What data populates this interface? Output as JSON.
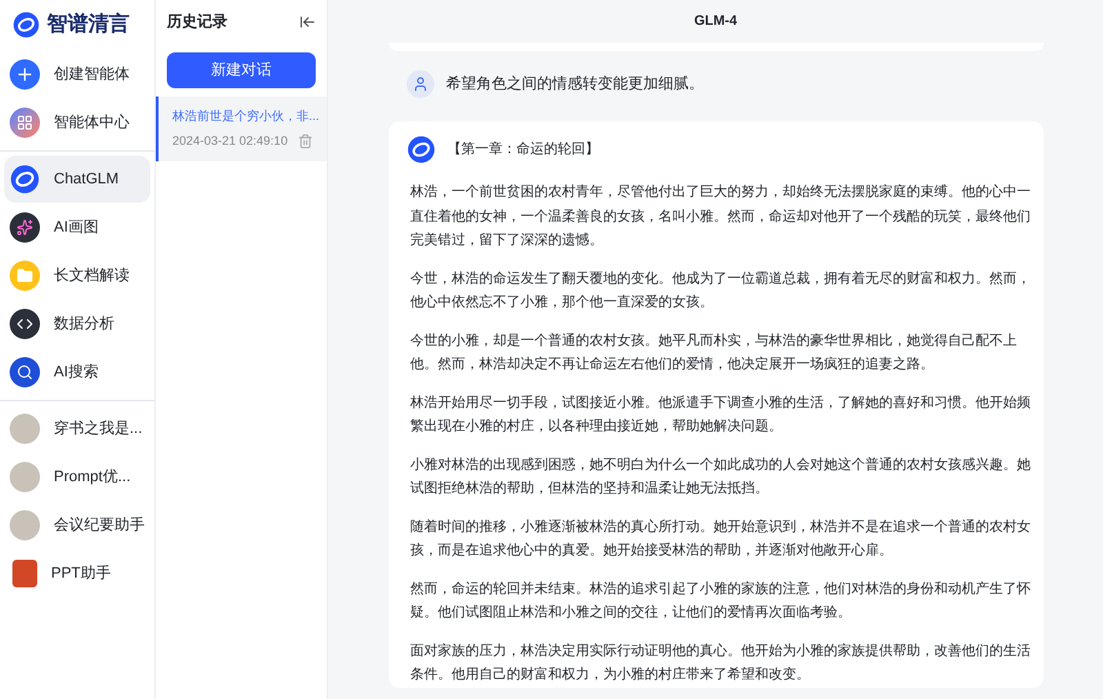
{
  "brand": {
    "name": "智谱清言"
  },
  "nav_groups": [
    {
      "items": [
        {
          "label": "创建智能体",
          "kind": "create",
          "selected": false
        },
        {
          "label": "智能体中心",
          "kind": "hub",
          "selected": false
        }
      ]
    },
    {
      "items": [
        {
          "label": "ChatGLM",
          "kind": "chat",
          "selected": true
        },
        {
          "label": "AI画图",
          "kind": "draw",
          "selected": false
        },
        {
          "label": "长文档解读",
          "kind": "doc",
          "selected": false
        },
        {
          "label": "数据分析",
          "kind": "code",
          "selected": false
        },
        {
          "label": "AI搜索",
          "kind": "search",
          "selected": false
        }
      ]
    },
    {
      "items": [
        {
          "label": "穿书之我是...",
          "kind": "avatar",
          "selected": false
        },
        {
          "label": "Prompt优...",
          "kind": "avatar",
          "selected": false
        },
        {
          "label": "会议纪要助手",
          "kind": "avatar",
          "selected": false
        },
        {
          "label": "PPT助手",
          "kind": "ppt",
          "selected": false
        }
      ]
    }
  ],
  "history": {
    "title": "历史记录",
    "new_button": "新建对话",
    "items": [
      {
        "title": "林浩前世是个穷小伙，非...",
        "time": "2024-03-21 02:49:10",
        "selected": true
      }
    ]
  },
  "chat": {
    "model": "GLM-4",
    "messages": [
      {
        "kind": "user",
        "text": "希望角色之间的情感转变能更加细腻。"
      },
      {
        "kind": "assistant",
        "heading": "【第一章：命运的轮回】",
        "paragraphs": [
          "林浩，一个前世贫困的农村青年，尽管他付出了巨大的努力，却始终无法摆脱家庭的束缚。他的心中一直住着他的女神，一个温柔善良的女孩，名叫小雅。然而，命运却对他开了一个残酷的玩笑，最终他们完美错过，留下了深深的遗憾。",
          "今世，林浩的命运发生了翻天覆地的变化。他成为了一位霸道总裁，拥有着无尽的财富和权力。然而，他心中依然忘不了小雅，那个他一直深爱的女孩。",
          "今世的小雅，却是一个普通的农村女孩。她平凡而朴实，与林浩的豪华世界相比，她觉得自己配不上他。然而，林浩却决定不再让命运左右他们的爱情，他决定展开一场疯狂的追妻之路。",
          "林浩开始用尽一切手段，试图接近小雅。他派遣手下调查小雅的生活，了解她的喜好和习惯。他开始频繁出现在小雅的村庄，以各种理由接近她，帮助她解决问题。",
          "小雅对林浩的出现感到困惑，她不明白为什么一个如此成功的人会对她这个普通的农村女孩感兴趣。她试图拒绝林浩的帮助，但林浩的坚持和温柔让她无法抵挡。",
          "随着时间的推移，小雅逐渐被林浩的真心所打动。她开始意识到，林浩并不是在追求一个普通的农村女孩，而是在追求他心中的真爱。她开始接受林浩的帮助，并逐渐对他敞开心扉。",
          "然而，命运的轮回并未结束。林浩的追求引起了小雅的家族的注意，他们对林浩的身份和动机产生了怀疑。他们试图阻止林浩和小雅之间的交往，让他们的爱情再次面临考验。",
          "面对家族的压力，林浩决定用实际行动证明他的真心。他开始为小雅的家族提供帮助，改善他们的生活条件。他用自己的财富和权力，为小雅的村庄带来了希望和改变。"
        ]
      }
    ]
  }
}
